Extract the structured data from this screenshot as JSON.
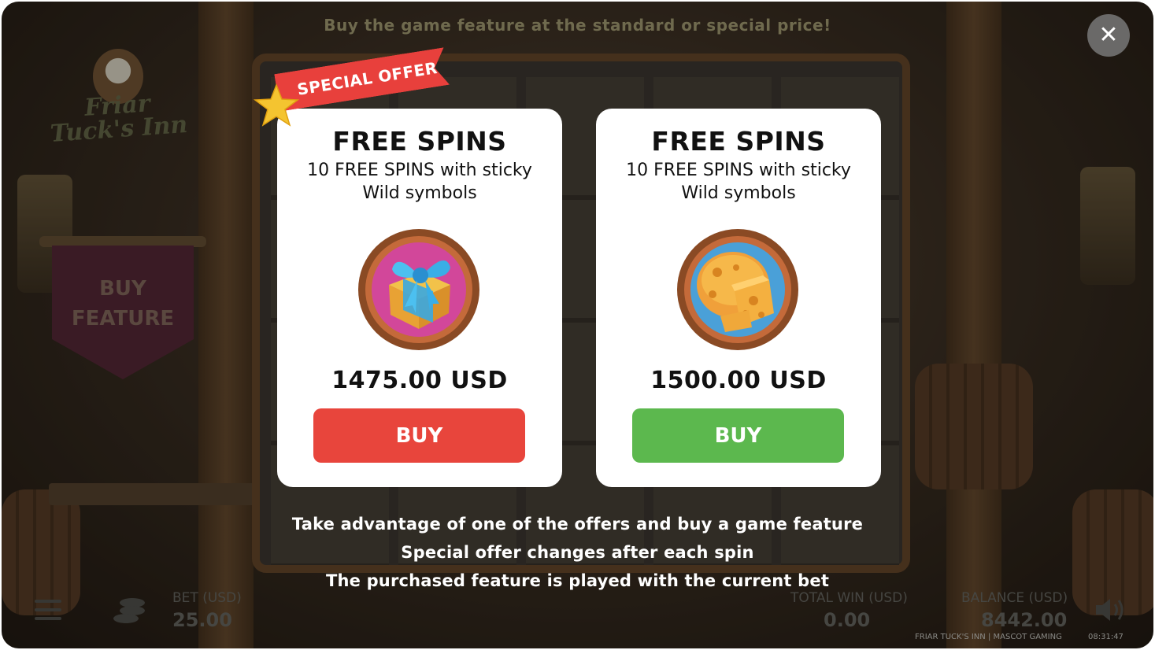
{
  "header": {
    "hint": "Buy the game feature at the standard or special price!",
    "close_symbol": "✕"
  },
  "game": {
    "logo_text": "Friar Tuck's Inn",
    "buy_feature_line1": "BUY",
    "buy_feature_line2": "FEATURE"
  },
  "ribbon": {
    "label": "SPECIAL OFFER",
    "color": "#e8403c"
  },
  "offers": [
    {
      "title": "FREE SPINS",
      "description": "10 FREE SPINS with sticky Wild symbols",
      "icon": "gift-box-icon",
      "price": "1475.00 USD",
      "buy_label": "BUY",
      "button_color": "#e8453c"
    },
    {
      "title": "FREE SPINS",
      "description": "10 FREE SPINS with sticky Wild symbols",
      "icon": "cheese-icon",
      "price": "1500.00 USD",
      "buy_label": "BUY",
      "button_color": "#5cb84e"
    }
  ],
  "info": {
    "line1": "Take advantage of one of the offers and buy a game feature",
    "line2": "Special offer changes after each spin",
    "line3": "The purchased feature is played with the current bet"
  },
  "bottom_bar": {
    "bet_label": "BET (USD)",
    "bet_value": "25.00",
    "total_win_label": "TOTAL WIN (USD)",
    "total_win_value": "0.00",
    "balance_label": "BALANCE (USD)",
    "balance_value": "8442.00",
    "brand": "FRIAR TUCK'S INN | MASCOT GAMING",
    "time": "08:31:47"
  }
}
